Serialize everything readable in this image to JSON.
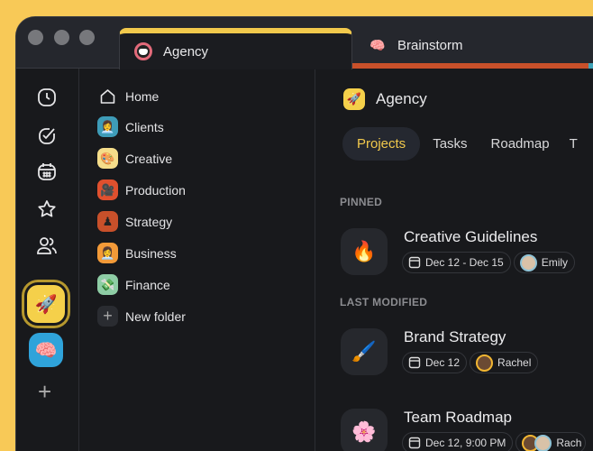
{
  "tabs": [
    {
      "label": "Agency",
      "icon": "helmet-icon",
      "active": true,
      "accent": "#F2C94C"
    },
    {
      "label": "Brainstorm",
      "icon": "brain-icon",
      "accent": "#C8502A"
    }
  ],
  "rail": {
    "icons": [
      "clock-icon",
      "check-circle-icon",
      "calendar-icon",
      "star-icon",
      "users-icon"
    ],
    "spaces": [
      {
        "emoji": "🚀",
        "color": "#F5D04A"
      },
      {
        "emoji": "🧠",
        "color": "#2FA3DA"
      }
    ]
  },
  "folders": [
    {
      "label": "Home"
    },
    {
      "label": "Clients",
      "emoji": "👩‍💼",
      "color": "#3E9CB8"
    },
    {
      "label": "Creative",
      "emoji": "🎨",
      "color": "#F5DD8A"
    },
    {
      "label": "Production",
      "emoji": "🎥",
      "color": "#E0502E"
    },
    {
      "label": "Strategy",
      "emoji": "♟",
      "color": "#C8502A"
    },
    {
      "label": "Business",
      "emoji": "👩‍💼",
      "color": "#F39A38"
    },
    {
      "label": "Finance",
      "emoji": "💸",
      "color": "#8ECDA5"
    },
    {
      "label": "New folder",
      "emoji": "+",
      "color": "#2a2c31"
    }
  ],
  "main": {
    "title": "Agency",
    "title_emoji": "🚀",
    "tabs": [
      "Projects",
      "Tasks",
      "Roadmap",
      "T"
    ],
    "pinned_label": "PINNED",
    "last_modified_label": "LAST MODIFIED",
    "projects": [
      {
        "emoji": "🔥",
        "title": "Creative Guidelines",
        "date": "Dec 12 - Dec 15",
        "person": "Emily"
      },
      {
        "emoji": "🖌️",
        "title": "Brand Strategy",
        "date": "Dec 12",
        "person": "Rachel"
      },
      {
        "emoji": "🌸",
        "title": "Team Roadmap",
        "date": "Dec 12, 9:00 PM",
        "person": "Rach"
      }
    ]
  }
}
